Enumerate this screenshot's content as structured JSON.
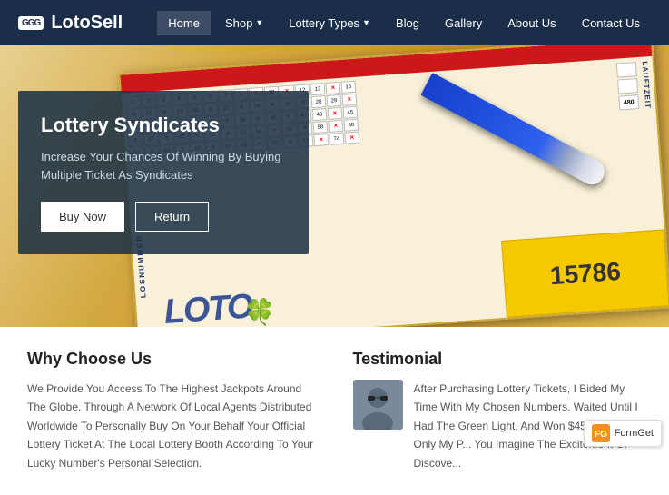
{
  "brand": {
    "icon": "GGG",
    "name": "LotoSell"
  },
  "navbar": {
    "items": [
      {
        "id": "home",
        "label": "Home",
        "active": true,
        "hasDropdown": false
      },
      {
        "id": "shop",
        "label": "Shop",
        "active": false,
        "hasDropdown": true
      },
      {
        "id": "lottery-types",
        "label": "Lottery Types",
        "active": false,
        "hasDropdown": true
      },
      {
        "id": "blog",
        "label": "Blog",
        "active": false,
        "hasDropdown": false
      },
      {
        "id": "gallery",
        "label": "Gallery",
        "active": false,
        "hasDropdown": false
      },
      {
        "id": "about-us",
        "label": "About Us",
        "active": false,
        "hasDropdown": false
      },
      {
        "id": "contact-us",
        "label": "Contact Us",
        "active": false,
        "hasDropdown": false
      }
    ]
  },
  "hero": {
    "title": "Lottery Syndicates",
    "subtitle": "Increase Your Chances Of Winning By Buying Multiple Ticket As Syndicates",
    "buy_now": "Buy Now",
    "return": "Return"
  },
  "why_choose": {
    "title": "Why Choose Us",
    "text": "We Provide You Access To The Highest Jackpots Around The Globe. Through A Network Of Local Agents Distributed Worldwide To Personally Buy On Your Behalf Your Official Lottery Ticket At The Local Lottery Booth According To Your Lucky Number's Personal Selection."
  },
  "testimonial": {
    "title": "Testimonial",
    "text": "After Purchasing Lottery Tickets, I Bided My Time With My Chosen Numbers. Waited Until I Had The Green Light, And Won $45k..this Was Only My P... You Imagine The Excitement Of Discove..."
  },
  "formget": {
    "label": "FormGet"
  },
  "colors": {
    "navbar_bg": "#1a2e4a",
    "hero_overlay": "rgba(30,50,70,0.88)",
    "accent": "#1a3a8a"
  }
}
